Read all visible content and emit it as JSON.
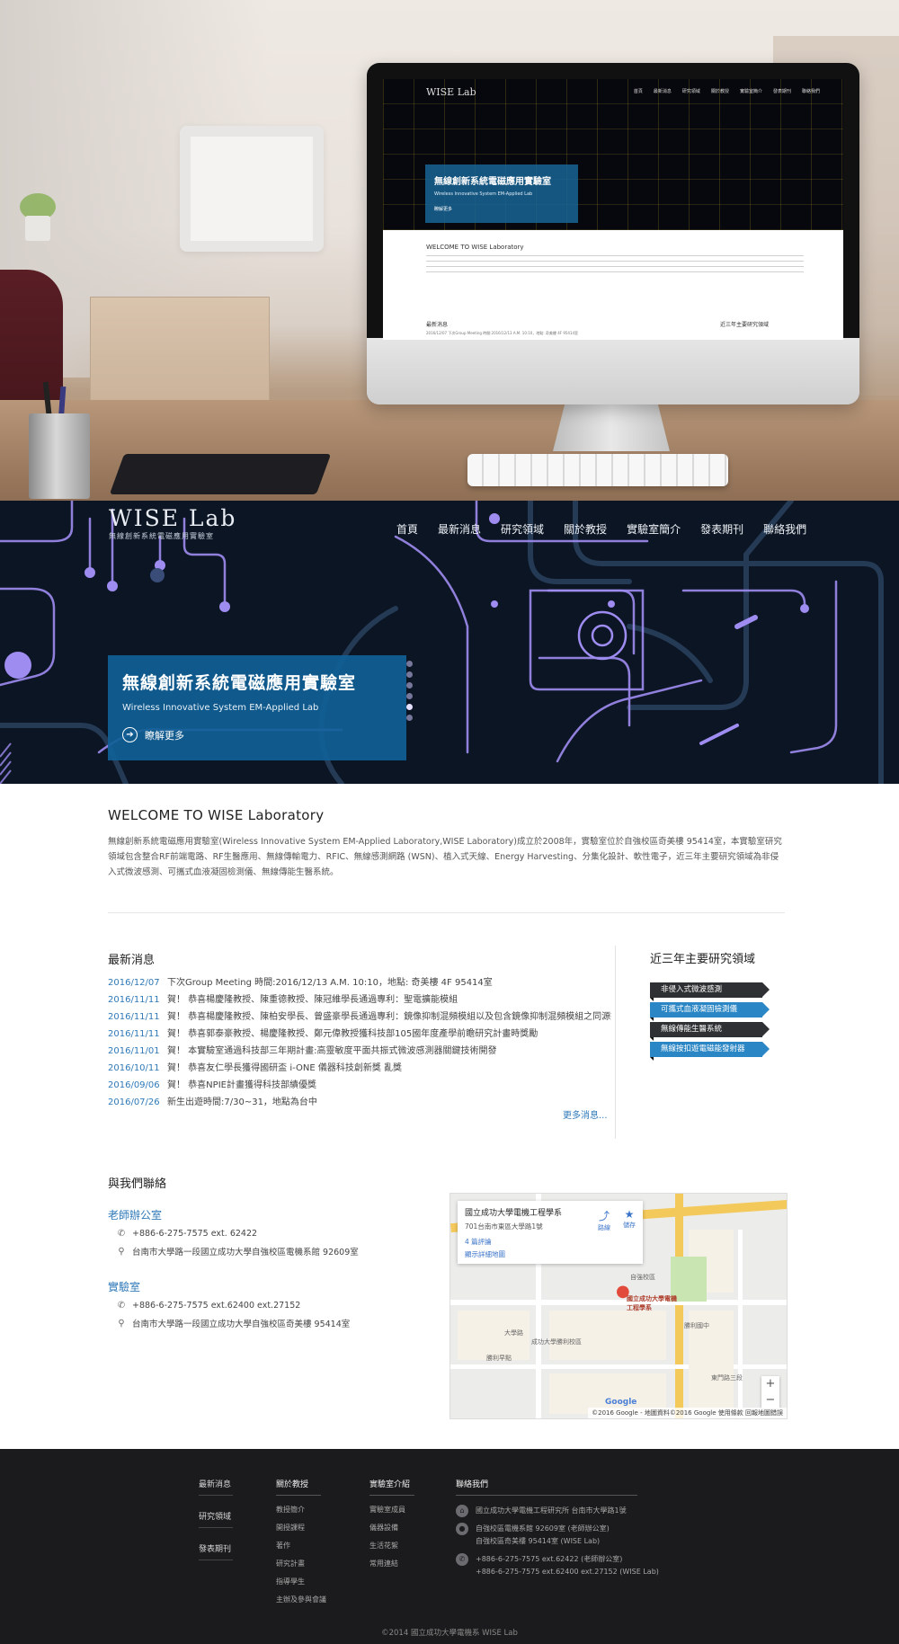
{
  "mockup_screen": {
    "logo": "WISE Lab",
    "nav": [
      "首頁",
      "最新消息",
      "研究領域",
      "關於教授",
      "實驗室簡介",
      "發表期刊",
      "聯絡我們"
    ],
    "hero_title": "無線創新系統電磁應用實驗室",
    "hero_sub": "Wireless Innovative System EM-Applied Lab",
    "hero_more": "瞭解更多",
    "welcome": "WELCOME TO WISE Laboratory",
    "news_title": "最新消息",
    "news_line": "2016/12/07   下次Group Meeting 時間:2016/12/13 A.M. 10:10，地點: 奇美樓 4F 95414室",
    "areas_title": "近三年主要研究領域"
  },
  "header": {
    "logo_main": "WISE Lab",
    "logo_sub": "無線創新系統電磁應用實驗室",
    "nav": [
      "首頁",
      "最新消息",
      "研究領域",
      "關於教授",
      "實驗室簡介",
      "發表期刊",
      "聯絡我們"
    ]
  },
  "hero": {
    "title": "無線創新系統電磁應用實驗室",
    "subtitle": "Wireless Innovative System EM-Applied Lab",
    "more": "瞭解更多",
    "slides": 6,
    "active_slide": 5
  },
  "welcome": {
    "title": "WELCOME TO WISE Laboratory",
    "body": "無線創新系統電磁應用實驗室(Wireless Innovative System EM-Applied Laboratory,WISE Laboratory)成立於2008年，實驗室位於自強校區奇美樓 95414室，本實驗室研究領域包含整合RF前端電路、RF生醫應用、無線傳輸電力、RFIC、無線感測網路 (WSN)、植入式天線、Energy Harvesting、分集化設計、軟性電子，近三年主要研究領域為非侵入式微波感測、可攜式血液凝固檢測儀、無線傳能生醫系統。"
  },
  "news": {
    "title": "最新消息",
    "items": [
      {
        "date": "2016/12/07",
        "text": "下次Group Meeting 時間:2016/12/13 A.M. 10:10，地點: 奇美樓 4F 95414室"
      },
      {
        "date": "2016/11/11",
        "text": "賀！ 恭喜楊慶隆教授、陳重德教授、陳冠維學長通過專利：聖電擴能模組"
      },
      {
        "date": "2016/11/11",
        "text": "賀！ 恭喜楊慶隆教授、陳柏安學長、曾盛豪學長通過專利：鏡像抑制混頻模組以及包含鏡像抑制混頻模組之同源接收機"
      },
      {
        "date": "2016/11/11",
        "text": "賀！ 恭喜郭泰豪教授、楊慶隆教授、鄭元偉教授獲科技部105國年度產學前瞻研究計畫時獎勵"
      },
      {
        "date": "2016/11/01",
        "text": "賀！ 本實驗室通過科技部三年期計畫:高靈敏度平面共振式微波感測器關鍵技術開發"
      },
      {
        "date": "2016/10/11",
        "text": "賀！ 恭喜友仁學長獲得國研盃 i-ONE 儀器科技創新獎 亂獎"
      },
      {
        "date": "2016/09/06",
        "text": "賀！ 恭喜NPIE計畫獲得科技部績優獎"
      },
      {
        "date": "2016/07/26",
        "text": "新生出遊時間:7/30~31，地點為台中"
      }
    ],
    "more": "更多消息..."
  },
  "research_areas": {
    "title": "近三年主要研究領域",
    "items": [
      "非侵入式微波感測",
      "可攜式血液凝固檢測儀",
      "無線傳能生醫系統",
      "無線按扣遊電磁能發射器"
    ]
  },
  "contact": {
    "title": "與我們聯絡",
    "office": {
      "title": "老師辦公室",
      "phone": "+886-6-275-7575 ext. 62422",
      "address": "台南市大學路一段國立成功大學自強校區電機系館 92609室"
    },
    "lab": {
      "title": "實驗室",
      "phone": "+886-6-275-7575 ext.62400 ext.27152",
      "address": "台南市大學路一段國立成功大學自強校區奇美樓 95414室"
    }
  },
  "map": {
    "place": "國立成功大學電機工程學系",
    "address": "701台南市東區大學路1號",
    "reviews": "4 篇評論",
    "details": "顯示詳細地圖",
    "route": "路線",
    "save": "儲存",
    "pin_label": "國立成功大學電機工程學系",
    "campus_label": "自強校區",
    "labels": [
      "成功大學勝利校區",
      "勝利早點",
      "勝利國中",
      "東門路三段",
      "大學路"
    ],
    "zoom_in": "+",
    "zoom_out": "−",
    "google": "Google",
    "attribution": "©2016 Google - 地圖資料©2016 Google  使用條款  回報地圖錯誤"
  },
  "footer": {
    "quick_links": [
      "最新消息",
      "研究領域",
      "發表期刊"
    ],
    "professor": {
      "title": "關於教授",
      "links": [
        "教授簡介",
        "開授課程",
        "著作",
        "研究計畫",
        "指導學生",
        "主辦及參與會議"
      ]
    },
    "lab_intro": {
      "title": "實驗室介紹",
      "links": [
        "實驗室成員",
        "儀器設備",
        "生活花絮",
        "常用連結"
      ]
    },
    "contact": {
      "title": "聯絡我們",
      "address": "國立成功大學電機工程研究所   台南市大學路1號",
      "rooms_1": "自強校區電機系館 92609室 (老師辦公室)",
      "rooms_2": "自強校區奇美樓 95414室  (WISE Lab)",
      "phone_1": "+886-6-275-7575 ext.62422  (老師辦公室)",
      "phone_2": "+886-6-275-7575 ext.62400 ext.27152  (WISE Lab)"
    },
    "copyright": "©2014 國立成功大學電機系 WISE Lab"
  },
  "colors": {
    "accent": "#2f79b8",
    "hero_box": "#10609a",
    "footer_bg": "#1b1b1d",
    "circuit": "#9f8cf0"
  }
}
